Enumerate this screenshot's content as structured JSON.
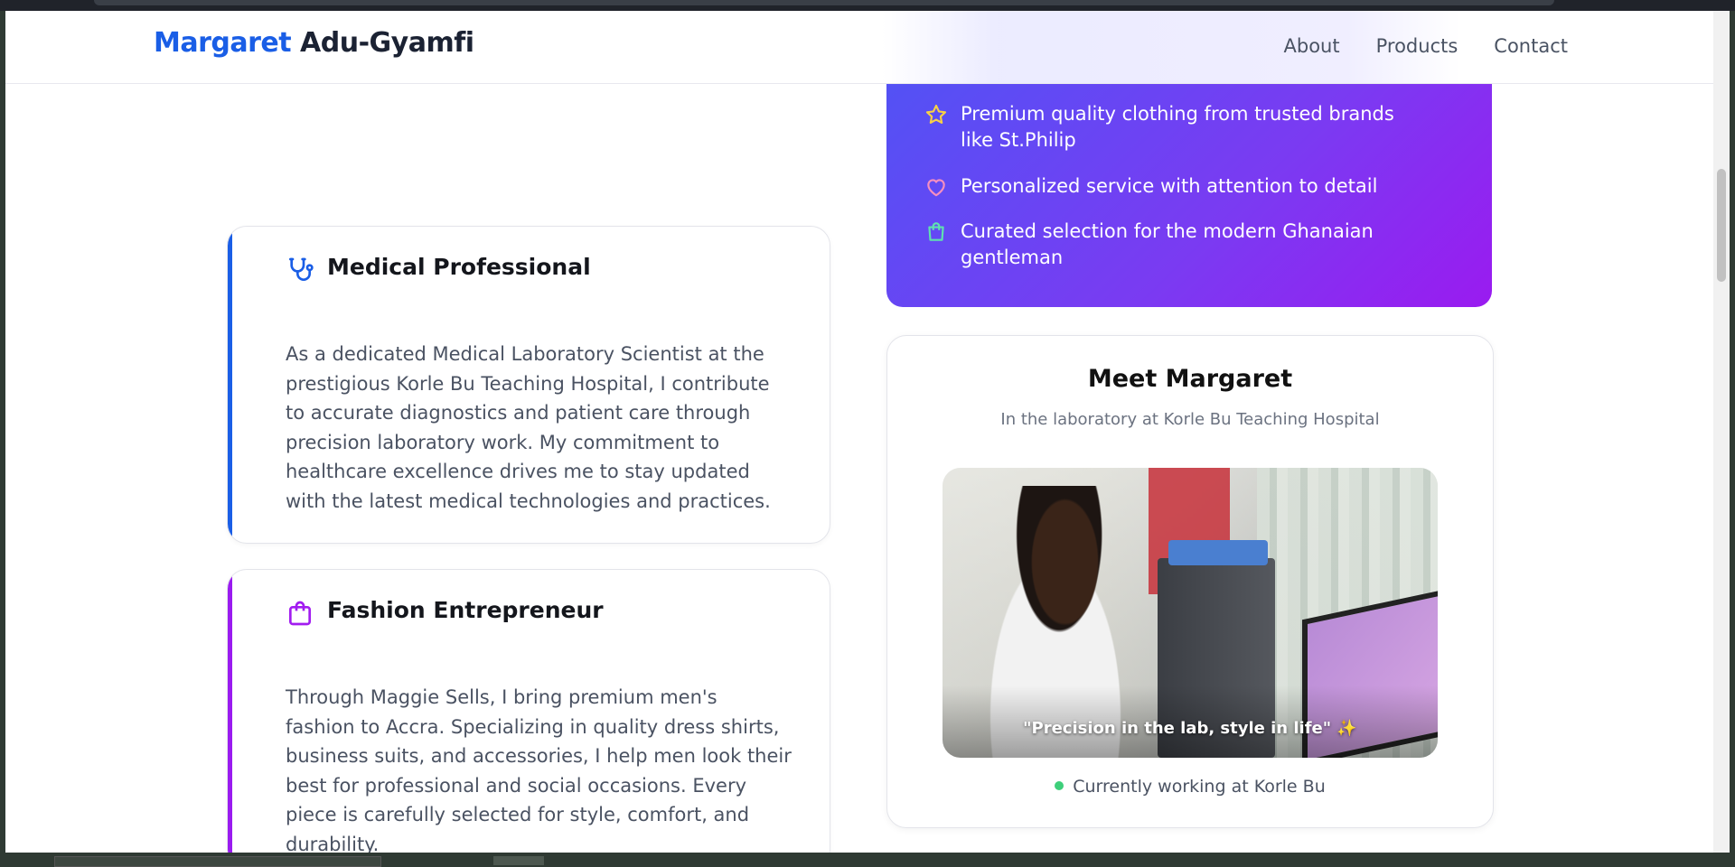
{
  "header": {
    "brand_first": "Margaret",
    "brand_last": "Adu-Gyamfi",
    "nav": [
      "About",
      "Products",
      "Contact"
    ]
  },
  "features": [
    {
      "icon": "star-icon",
      "text": "Premium quality clothing from trusted brands like St.Philip"
    },
    {
      "icon": "heart-icon",
      "text": "Personalized service with attention to detail"
    },
    {
      "icon": "shopping-bag-icon",
      "text": "Curated selection for the modern Ghanaian gentleman"
    }
  ],
  "cards": [
    {
      "icon": "stethoscope-icon",
      "title": "Medical Professional",
      "body": "As a dedicated Medical Laboratory Scientist at the prestigious Korle Bu Teaching Hospital, I contribute to accurate diagnostics and patient care through precision laboratory work. My commitment to healthcare excellence drives me to stay updated with the latest medical technologies and practices."
    },
    {
      "icon": "shopping-bag-icon",
      "title": "Fashion Entrepreneur",
      "body": "Through Maggie Sells, I bring premium men's fashion to Accra. Specializing in quality dress shirts, business suits, and accessories, I help men look their best for professional and social occasions. Every piece is carefully selected for style, comfort, and durability."
    }
  ],
  "meet": {
    "title": "Meet Margaret",
    "subtitle": "In the laboratory at Korle Bu Teaching Hospital",
    "quote": "\"Precision in the lab, style in life\" ✨",
    "status": "Currently working at Korle Bu"
  },
  "colors": {
    "brand_blue": "#1a5ee6",
    "purple_start": "#4d55f5",
    "purple_end": "#9a1bf0",
    "status_green": "#3ecf7a"
  }
}
